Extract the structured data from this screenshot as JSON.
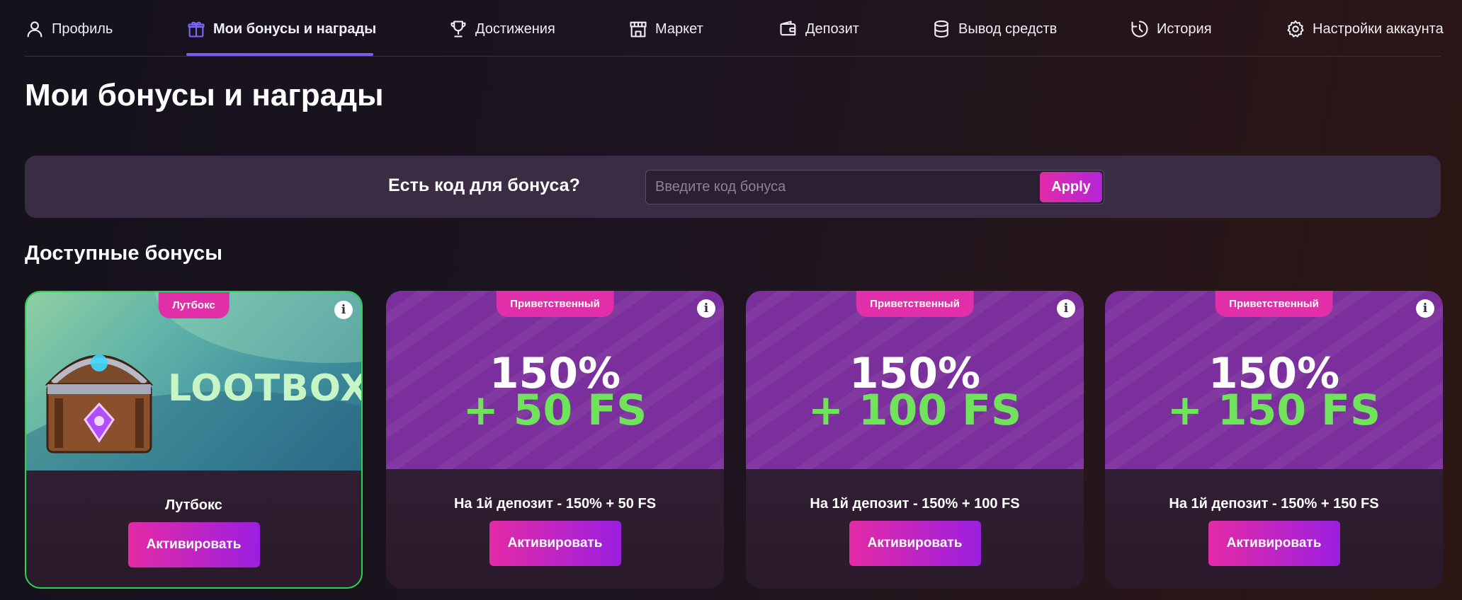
{
  "nav": {
    "items": [
      {
        "label": "Профиль",
        "icon": "user-icon"
      },
      {
        "label": "Мои бонусы и награды",
        "icon": "gift-icon",
        "active": true
      },
      {
        "label": "Достижения",
        "icon": "trophy-icon"
      },
      {
        "label": "Маркет",
        "icon": "store-icon"
      },
      {
        "label": "Депозит",
        "icon": "wallet-icon"
      },
      {
        "label": "Вывод средств",
        "icon": "database-icon"
      },
      {
        "label": "История",
        "icon": "history-icon"
      },
      {
        "label": "Настройки аккаунта",
        "icon": "gear-icon"
      }
    ]
  },
  "page": {
    "title": "Мои бонусы и награды"
  },
  "bonus_code": {
    "question": "Есть код для бонуса?",
    "placeholder": "Введите код бонуса",
    "value": "",
    "apply_label": "Apply"
  },
  "section": {
    "title": "Доступные бонусы"
  },
  "cards": [
    {
      "tag": "Лутбокс",
      "image_text": "LOOTBOX",
      "title": "Лутбокс",
      "button": "Активировать",
      "info": "i"
    },
    {
      "tag": "Приветственный",
      "line1": "150%",
      "line2": "+ 50 FS",
      "title": "На 1й депозит - 150% + 50 FS",
      "button": "Активировать",
      "info": "i"
    },
    {
      "tag": "Приветственный",
      "line1": "150%",
      "line2": "+ 100 FS",
      "title": "На 1й депозит - 150% + 100 FS",
      "button": "Активировать",
      "info": "i"
    },
    {
      "tag": "Приветственный",
      "line1": "150%",
      "line2": "+ 150 FS",
      "title": "На 1й депозит - 150% + 150 FS",
      "button": "Активировать",
      "info": "i"
    }
  ],
  "colors": {
    "accent_purple": "#7a5cf0",
    "button_gradient_start": "#e42aa6",
    "button_gradient_end": "#9b1fe0",
    "promo_green": "#6fe35a",
    "lootbox_border": "#2bd352"
  }
}
